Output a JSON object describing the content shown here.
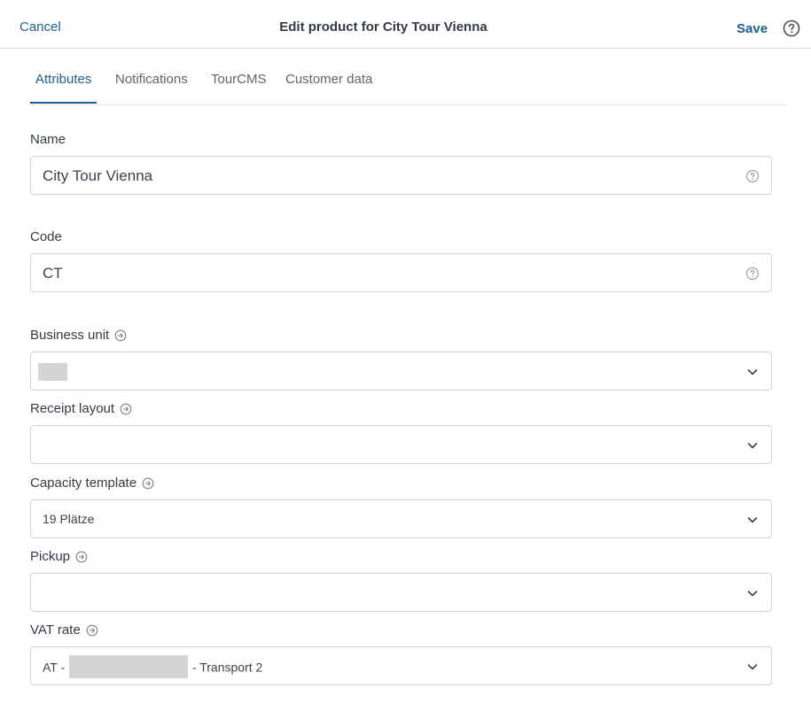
{
  "header": {
    "cancel_label": "Cancel",
    "title": "Edit product for City Tour Vienna",
    "save_label": "Save"
  },
  "tabs": [
    {
      "label": "Attributes",
      "active": true
    },
    {
      "label": "Notifications",
      "active": false
    },
    {
      "label": "TourCMS",
      "active": false
    },
    {
      "label": "Customer data",
      "active": false
    }
  ],
  "form": {
    "name": {
      "label": "Name",
      "value": "City Tour Vienna"
    },
    "code": {
      "label": "Code",
      "value": "CT"
    },
    "business_unit": {
      "label": "Business unit",
      "value": ""
    },
    "receipt_layout": {
      "label": "Receipt layout",
      "value": ""
    },
    "capacity_template": {
      "label": "Capacity template",
      "value": "19 Plätze"
    },
    "pickup": {
      "label": "Pickup",
      "value": ""
    },
    "vat_rate": {
      "label": "VAT rate",
      "value_prefix": "AT -",
      "value_suffix": "- Transport 2"
    }
  },
  "colors": {
    "accent": "#1f5f8b",
    "text": "#333a45",
    "border": "#cfd3d8",
    "redacted": "#d3d4d6"
  },
  "icons": {
    "help": "question-circle-icon",
    "field_help": "question-circle-icon",
    "link": "arrow-right-circle-icon",
    "dropdown": "chevron-down-icon"
  }
}
